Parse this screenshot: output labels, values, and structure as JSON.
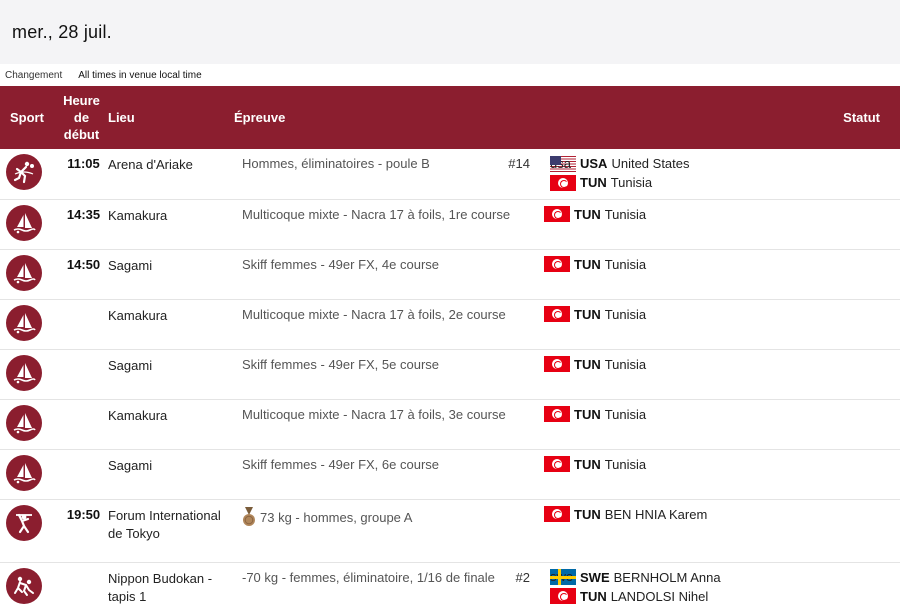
{
  "header": {
    "date": "mer., 28 juil."
  },
  "subbar": {
    "change_label": "Changement",
    "timezone_label": "All times in venue local time"
  },
  "columns": {
    "sport": "Sport",
    "time_line1": "Heure",
    "time_line2": "de",
    "time_line3": "début",
    "venue": "Lieu",
    "event": "Épreuve",
    "status": "Statut"
  },
  "rows": [
    {
      "sport_icon": "handball-icon",
      "time": "11:05",
      "venue": "Arena d'Ariake",
      "event": "Hommes, éliminatoires - poule B",
      "number": "#14",
      "teams": [
        {
          "flag": "usa",
          "code": "USA",
          "name": "United States"
        },
        {
          "flag": "tun",
          "code": "TUN",
          "name": "Tunisia"
        }
      ]
    },
    {
      "sport_icon": "sailing-icon",
      "time": "14:35",
      "venue": "Kamakura",
      "event": "Multicoque mixte - Nacra 17 à foils, 1re course",
      "number": "",
      "teams": [
        {
          "flag": "tun",
          "code": "TUN",
          "name": "Tunisia"
        }
      ]
    },
    {
      "sport_icon": "sailing-icon",
      "time": "14:50",
      "venue": "Sagami",
      "event": "Skiff femmes - 49er FX, 4e course",
      "number": "",
      "teams": [
        {
          "flag": "tun",
          "code": "TUN",
          "name": "Tunisia"
        }
      ]
    },
    {
      "sport_icon": "sailing-icon",
      "time": "",
      "venue": "Kamakura",
      "event": "Multicoque mixte - Nacra 17 à foils, 2e course",
      "number": "",
      "teams": [
        {
          "flag": "tun",
          "code": "TUN",
          "name": "Tunisia"
        }
      ]
    },
    {
      "sport_icon": "sailing-icon",
      "time": "",
      "venue": "Sagami",
      "event": "Skiff femmes - 49er FX, 5e course",
      "number": "",
      "teams": [
        {
          "flag": "tun",
          "code": "TUN",
          "name": "Tunisia"
        }
      ]
    },
    {
      "sport_icon": "sailing-icon",
      "time": "",
      "venue": "Kamakura",
      "event": "Multicoque mixte - Nacra 17 à foils, 3e course",
      "number": "",
      "teams": [
        {
          "flag": "tun",
          "code": "TUN",
          "name": "Tunisia"
        }
      ]
    },
    {
      "sport_icon": "sailing-icon",
      "time": "",
      "venue": "Sagami",
      "event": "Skiff femmes - 49er FX, 6e course",
      "number": "",
      "teams": [
        {
          "flag": "tun",
          "code": "TUN",
          "name": "Tunisia"
        }
      ]
    },
    {
      "sport_icon": "weightlifting-icon",
      "time": "19:50",
      "venue": "Forum International de Tokyo",
      "event": "73 kg - hommes, groupe A",
      "number": "",
      "medal": "bronze-medal-icon",
      "teams": [
        {
          "flag": "tun",
          "code": "TUN",
          "name": "BEN HNIA Karem"
        }
      ]
    },
    {
      "sport_icon": "judo-icon",
      "time": "",
      "venue": "Nippon Budokan - tapis 1",
      "event": "-70 kg - femmes, éliminatoire, 1/16 de finale",
      "number": "#2",
      "teams": [
        {
          "flag": "swe",
          "code": "SWE",
          "name": "BERNHOLM Anna"
        },
        {
          "flag": "tun",
          "code": "TUN",
          "name": "LANDOLSI Nihel"
        }
      ]
    }
  ],
  "colors": {
    "header_bg": "#8b1e2f",
    "icon_bg": "#8b1e2f",
    "date_bar_bg": "#f4f4f6"
  }
}
